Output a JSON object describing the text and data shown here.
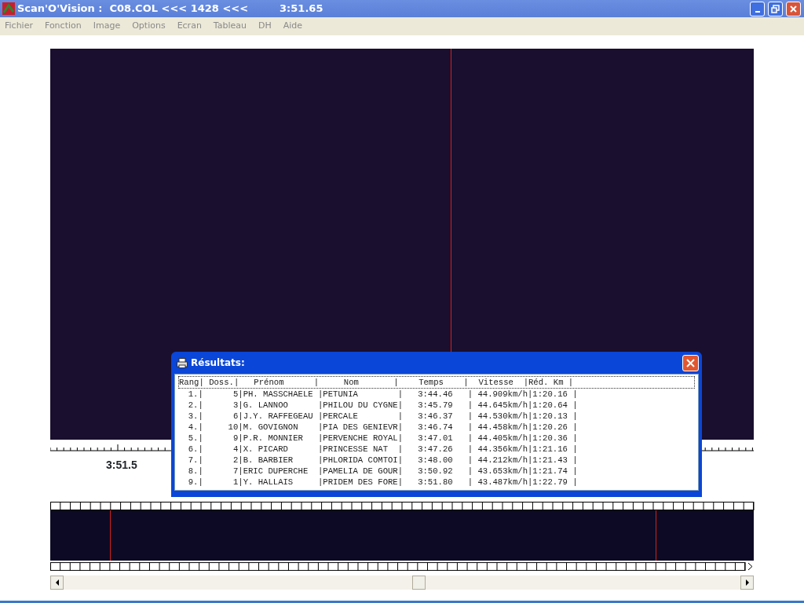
{
  "window": {
    "app_name": "Scan'O'Vision :",
    "file_info": "C08.COL <<< 1428 <<<",
    "time": "3:51.65"
  },
  "menu": [
    "Fichier",
    "Fonction",
    "Image",
    "Options",
    "Ecran",
    "Tableau",
    "DH",
    "Aide"
  ],
  "timeline": {
    "label": "3:51.5"
  },
  "results_dialog": {
    "title": "Résultats:",
    "header": "Rang| Doss.|   Prénom      |     Nom       |    Temps    |  Vitesse  |Réd. Km |",
    "rows": [
      "  1.|      5|PH. MASSCHAELE |PETUNIA        |   3:44.46   | 44.909km/h|1:20.16 |",
      "  2.|      3|G. LANNOO      |PHILOU DU CYGNE|   3:45.79   | 44.645km/h|1:20.64 |",
      "  3.|      6|J.Y. RAFFEGEAU |PERCALE        |   3:46.37   | 44.530km/h|1:20.13 |",
      "  4.|     10|M. GOVIGNON    |PIA DES GENIEVR|   3:46.74   | 44.458km/h|1:20.26 |",
      "  5.|      9|P.R. MONNIER   |PERVENCHE ROYAL|   3:47.01   | 44.405km/h|1:20.36 |",
      "  6.|      4|X. PICARD      |PRINCESSE NAT  |   3:47.26   | 44.356km/h|1:21.16 |",
      "  7.|      2|B. BARBIER     |PHLORIDA COMTOI|   3:48.00   | 44.212km/h|1:21.43 |",
      "  8.|      7|ERIC DUPERCHE  |PAMELIA DE GOUR|   3:50.92   | 43.653km/h|1:21.74 |",
      "  9.|      1|Y. HALLAIS     |PRIDEM DES FORE|   3:51.80   | 43.487km/h|1:22.79 |"
    ]
  }
}
